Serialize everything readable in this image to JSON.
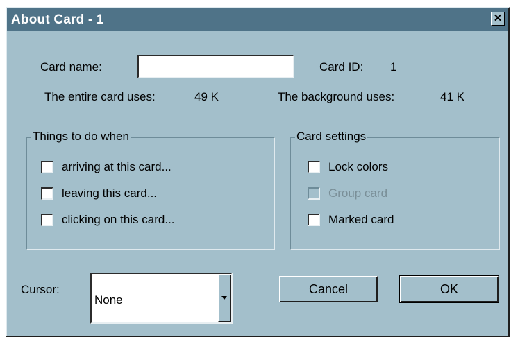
{
  "dialog": {
    "title": "About Card - 1",
    "close_glyph": "✕"
  },
  "card": {
    "name_label": "Card name:",
    "name_value": "",
    "id_label": "Card ID:",
    "id_value": "1",
    "entire_uses_label": "The entire card uses:",
    "entire_uses_value": "49 K",
    "background_uses_label": "The background uses:",
    "background_uses_value": "41 K"
  },
  "things_group": {
    "title": "Things to do when",
    "items": [
      {
        "label": "arriving at this card...",
        "checked": false,
        "enabled": true
      },
      {
        "label": "leaving this card...",
        "checked": false,
        "enabled": true
      },
      {
        "label": "clicking on this card...",
        "checked": false,
        "enabled": true
      }
    ]
  },
  "settings_group": {
    "title": "Card settings",
    "items": [
      {
        "label": "Lock colors",
        "checked": false,
        "enabled": true
      },
      {
        "label": "Group card",
        "checked": false,
        "enabled": false
      },
      {
        "label": "Marked card",
        "checked": false,
        "enabled": true
      }
    ]
  },
  "cursor": {
    "label": "Cursor:",
    "value": "None"
  },
  "buttons": {
    "cancel": "Cancel",
    "ok": "OK"
  },
  "colors": {
    "dialog_bg": "#a3bfcb",
    "titlebar_bg": "#4f7388",
    "disabled_text": "#7a8f98"
  }
}
